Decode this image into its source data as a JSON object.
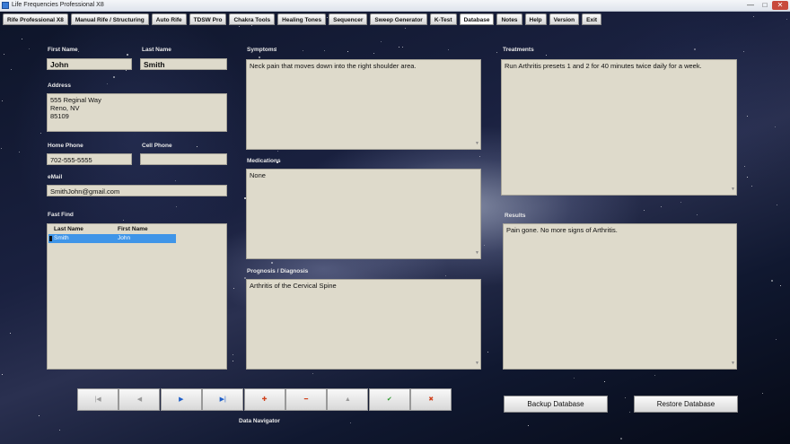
{
  "window": {
    "title": "Life Frequencies Professional X8",
    "minimize": "—",
    "maximize": "□",
    "close": "✕"
  },
  "tabs": [
    "Rife Professional X8",
    "Manual Rife / Structuring",
    "Auto Rife",
    "TDSW Pro",
    "Chakra Tools",
    "Healing Tones",
    "Sequencer",
    "Sweep Generator",
    "K-Test",
    "Database",
    "Notes",
    "Help",
    "Version",
    "Exit"
  ],
  "active_tab": "Database",
  "labels": {
    "first_name": "First Name",
    "last_name": "Last Name",
    "address": "Address",
    "home_phone": "Home Phone",
    "cell_phone": "Cell Phone",
    "email": "eMail",
    "fast_find": "Fast Find",
    "symptoms": "Symptoms",
    "medications": "Medications",
    "prognosis": "Prognosis / Diagnosis",
    "treatments": "Treatments",
    "results": "Results",
    "data_navigator": "Data Navigator"
  },
  "fields": {
    "first_name": "John",
    "last_name": "Smith",
    "address_line1": "555 Reginal Way",
    "address_line2": "Reno, NV",
    "address_line3": "85109",
    "home_phone": "702-555-5555",
    "cell_phone": "",
    "email": "SmithJohn@gmail.com",
    "symptoms": "Neck pain that moves down into the right shoulder area.",
    "medications": "None",
    "prognosis": "Arthritis of the Cervical Spine",
    "treatments": "Run Arthritis presets 1 and 2 for 40 minutes twice daily for a week.",
    "results": "Pain gone. No more signs of Arthritis."
  },
  "fast_find": {
    "columns": [
      "Last Name",
      "First Name"
    ],
    "rows": [
      [
        "Smith",
        "John"
      ]
    ]
  },
  "navigator": {
    "buttons": [
      {
        "icon": "first-record-icon",
        "glyph": "|◀",
        "color": "#9a9a9a"
      },
      {
        "icon": "prior-record-icon",
        "glyph": "◀",
        "color": "#9a9a9a"
      },
      {
        "icon": "next-record-icon",
        "glyph": "▶",
        "color": "#1f5fc9"
      },
      {
        "icon": "last-record-icon",
        "glyph": "▶|",
        "color": "#1f5fc9"
      },
      {
        "icon": "insert-record-icon",
        "glyph": "✚",
        "color": "#d0411c"
      },
      {
        "icon": "delete-record-icon",
        "glyph": "━",
        "color": "#d0411c"
      },
      {
        "icon": "edit-record-icon",
        "glyph": "▲",
        "color": "#9a9a9a"
      },
      {
        "icon": "post-edit-icon",
        "glyph": "✔",
        "color": "#2b9a2b"
      },
      {
        "icon": "cancel-edit-icon",
        "glyph": "✖",
        "color": "#d0411c"
      }
    ]
  },
  "buttons": {
    "backup": "Backup Database",
    "restore": "Restore Database"
  }
}
